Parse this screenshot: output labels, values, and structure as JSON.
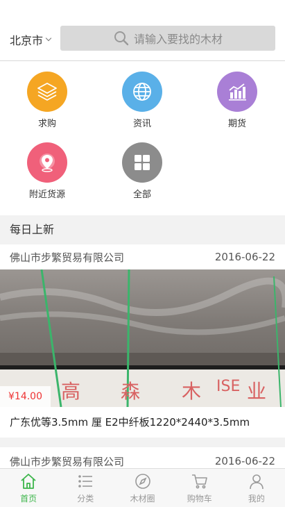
{
  "header": {
    "city": "北京市",
    "search_placeholder": "请输入要找的木材"
  },
  "categories": [
    {
      "label": "求购",
      "icon": "layers-icon",
      "color": "#f5a623"
    },
    {
      "label": "资讯",
      "icon": "globe-icon",
      "color": "#5ab0e8"
    },
    {
      "label": "期货",
      "icon": "chart-icon",
      "color": "#a97fd6"
    },
    {
      "label": "附近货源",
      "icon": "location-icon",
      "color": "#f0607a"
    },
    {
      "label": "全部",
      "icon": "grid-icon",
      "color": "#8c8c8c"
    }
  ],
  "section_title": "每日上新",
  "products": [
    {
      "company": "佛山市步繁贸易有限公司",
      "date": "2016-06-22",
      "price": "¥14.00",
      "title": "广东优等3.5mm 厘 E2中纤板1220*2440*3.5mm",
      "image_text": [
        "高",
        "森",
        "木",
        "ISE",
        "业"
      ]
    },
    {
      "company": "佛山市步繁贸易有限公司",
      "date": "2016-06-22"
    }
  ],
  "tabbar": [
    {
      "label": "首页",
      "icon": "home-icon",
      "active": true
    },
    {
      "label": "分类",
      "icon": "list-icon",
      "active": false
    },
    {
      "label": "木材圈",
      "icon": "compass-icon",
      "active": false
    },
    {
      "label": "购物车",
      "icon": "cart-icon",
      "active": false
    },
    {
      "label": "我的",
      "icon": "user-icon",
      "active": false
    }
  ],
  "colors": {
    "accent": "#3cb54a",
    "price": "#ee3333"
  }
}
